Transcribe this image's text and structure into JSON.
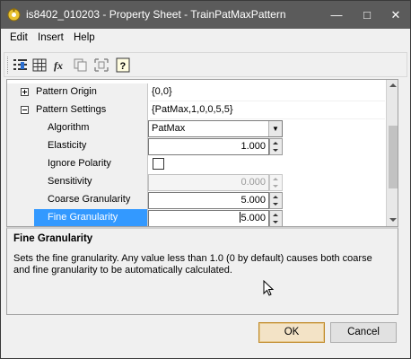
{
  "window": {
    "title": "is8402_010203 - Property Sheet - TrainPatMaxPattern",
    "controls": {
      "minimize": "—",
      "maximize": "□",
      "close": "✕"
    }
  },
  "menu": {
    "items": [
      "Edit",
      "Insert",
      "Help"
    ]
  },
  "toolbar": {
    "icons": [
      "properties-list-icon",
      "grid-icon",
      "fx-icon",
      "copy-icon",
      "move-icon",
      "help-icon"
    ]
  },
  "grid": {
    "rows": [
      {
        "name": "Pattern Origin",
        "value": "{0,0}",
        "kind": "category-collapsed"
      },
      {
        "name": "Pattern Settings",
        "value": "{PatMax,1,0,0,5,5}",
        "kind": "category-expanded"
      },
      {
        "name": "Algorithm",
        "value": "PatMax",
        "kind": "combo"
      },
      {
        "name": "Elasticity",
        "value": "1.000",
        "kind": "spin"
      },
      {
        "name": "Ignore Polarity",
        "value": "",
        "kind": "checkbox",
        "checked": false
      },
      {
        "name": "Sensitivity",
        "value": "0.000",
        "kind": "spin-disabled"
      },
      {
        "name": "Coarse Granularity",
        "value": "5.000",
        "kind": "spin"
      },
      {
        "name": "Fine Granularity",
        "value": "5.000",
        "value_before_caret": "",
        "value_after_caret": "5.000",
        "kind": "spin-editing",
        "selected": true
      }
    ]
  },
  "description": {
    "title": "Fine Granularity",
    "text": "Sets the fine granularity.  Any value less than 1.0 (0 by default) causes both coarse and fine granularity to be automatically calculated."
  },
  "buttons": {
    "ok": "OK",
    "cancel": "Cancel"
  },
  "colors": {
    "titlebar": "#5b5b5b",
    "selection": "#3399ff",
    "dialog_bg": "#f0f0f0"
  }
}
